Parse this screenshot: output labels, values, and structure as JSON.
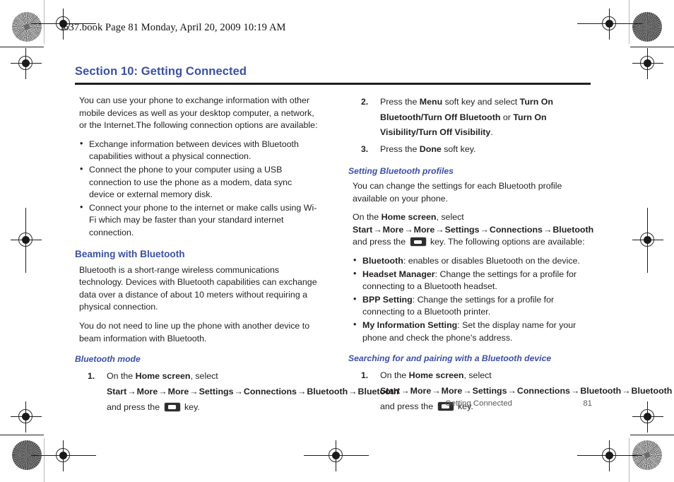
{
  "page": {
    "slug": "i637.book  Page 81  Monday, April 20, 2009  10:19 AM",
    "accent_color": "#3b50a8",
    "text_color": "#231f20",
    "footer_color": "#58595b"
  },
  "section": {
    "title": "Section 10: Getting Connected"
  },
  "left_column": {
    "intro": "You can use your phone to exchange information with other mobile devices as well as your desktop computer, a network, or the Internet.The following connection options are available:",
    "intro_bullets": [
      "Exchange information between devices with Bluetooth capabilities without a physical connection.",
      "Connect the phone to your computer using a USB connection to use the phone as a modem, data sync device or external memory disk.",
      "Connect your phone to the internet or make calls using Wi-Fi which may be faster than your standard internet connection."
    ],
    "beaming_heading": "Beaming with Bluetooth",
    "beaming_p1": "Bluetooth is a short-range wireless communications technology. Devices with Bluetooth capabilities can exchange data over a distance of about 10 meters without requiring a physical connection.",
    "beaming_p2": "You do not need to line up the phone with another device to beam information with Bluetooth.",
    "bluetooth_mode_heading": "Bluetooth mode",
    "step1": {
      "number": "1.",
      "prefix": "On the ",
      "home_screen": "Home screen",
      "select": ", select ",
      "path": [
        "Start",
        "More",
        "More",
        "Settings",
        "Connections",
        "Bluetooth",
        "Bluetooth"
      ],
      "and": " and ",
      "press_the": "press the ",
      "key_icon": "ok-key-icon",
      "key_word": " key."
    }
  },
  "right_column": {
    "step2": {
      "number": "2.",
      "t1": "Press the ",
      "menu": "Menu",
      "t2": " soft key and select ",
      "opt1": "Turn On Bluetooth/Turn Off Bluetooth",
      "t3": " or ",
      "opt2": "Turn On Visibility/Turn Off Visibility",
      "t4": "."
    },
    "step3": {
      "number": "3.",
      "t1": "Press the ",
      "done": "Done",
      "t2": " soft key."
    },
    "profiles_heading": "Setting Bluetooth profiles",
    "profiles_p1": "You can change the settings for each Bluetooth profile available on your phone.",
    "profiles_path": {
      "prefix": "On the ",
      "home_screen": "Home screen",
      "select": ", select ",
      "path": [
        "Start",
        "More",
        "More",
        "Settings",
        "Connections",
        "Bluetooth"
      ],
      "and_press": " and press the ",
      "key_icon": "ok-key-icon",
      "suffix": " key. The following options are available:"
    },
    "option_bullets": [
      {
        "term": "Bluetooth",
        "desc": ": enables or disables Bluetooth on the device."
      },
      {
        "term": "Headset Manager",
        "desc": ": Change the settings for a profile for connecting to a Bluetooth headset."
      },
      {
        "term": "BPP Setting",
        "desc": ": Change the settings for a profile for connecting to a Bluetooth printer."
      },
      {
        "term": "My Information Setting",
        "desc": ": Set the display name for your phone and check the phone's address."
      }
    ],
    "searching_heading": "Searching for and pairing with a Bluetooth device",
    "step1": {
      "number": "1.",
      "prefix": "On the ",
      "home_screen": "Home screen",
      "select": ", select ",
      "path": [
        "Start",
        "More",
        "More",
        "Settings",
        "Connections",
        "Bluetooth",
        "Bluetooth"
      ],
      "and": " and ",
      "press_the": "press the ",
      "key_icon": "ok-key-icon",
      "key_word": " key."
    }
  },
  "footer": {
    "chapter": "Getting Connected",
    "page_number": "81"
  }
}
